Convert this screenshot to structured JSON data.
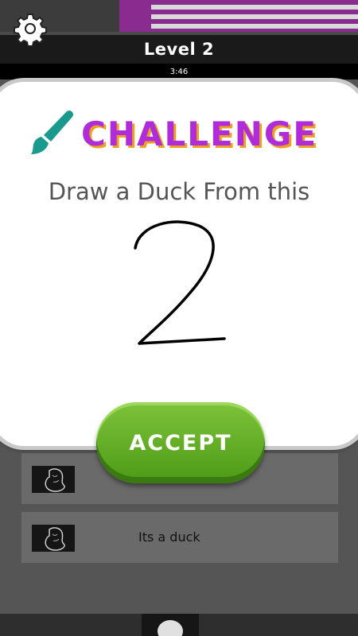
{
  "header": {
    "level_title": "Level 2",
    "timer": "3:46"
  },
  "modal": {
    "title": "CHALLENGE",
    "prompt": "Draw a Duck From this",
    "accept_label": "ACCEPT"
  },
  "list": [
    {
      "text": ""
    },
    {
      "text": "Its a duck"
    }
  ],
  "icons": {
    "settings": "gear-icon",
    "challenge": "paintbrush-icon"
  },
  "colors": {
    "title": "#b02bd9",
    "title_shadow": "#f0a020",
    "accept": "#5aa61f",
    "brush": "#1a9a8e"
  }
}
